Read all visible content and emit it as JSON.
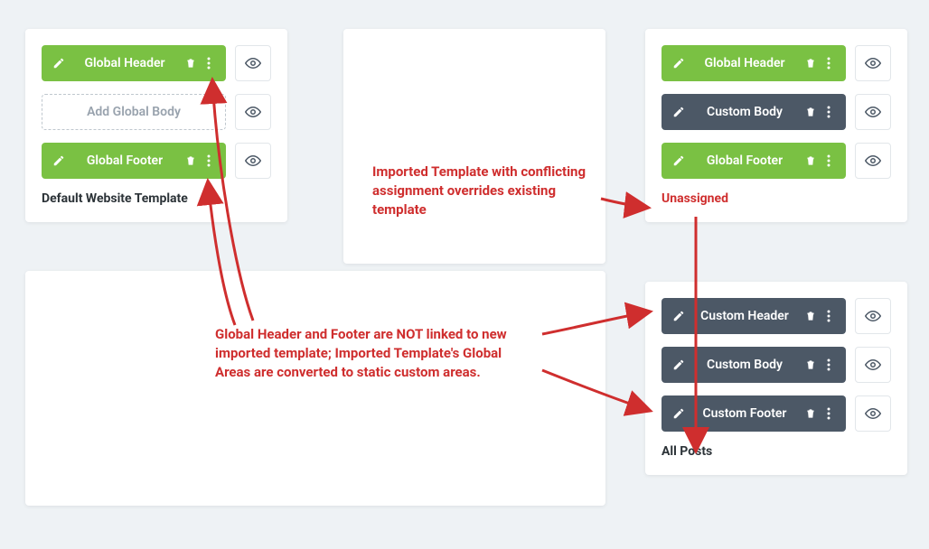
{
  "templates": {
    "default": {
      "title": "Default Website Template",
      "rows": [
        {
          "kind": "green",
          "label": "Global Header"
        },
        {
          "kind": "dashed",
          "label": "Add Global Body"
        },
        {
          "kind": "green",
          "label": "Global Footer"
        }
      ]
    },
    "unassigned": {
      "title": "Unassigned",
      "title_red": true,
      "rows": [
        {
          "kind": "green",
          "label": "Global Header"
        },
        {
          "kind": "dark",
          "label": "Custom Body"
        },
        {
          "kind": "green",
          "label": "Global Footer"
        }
      ]
    },
    "allposts": {
      "title": "All Posts",
      "rows": [
        {
          "kind": "dark",
          "label": "Custom Header"
        },
        {
          "kind": "dark",
          "label": "Custom Body"
        },
        {
          "kind": "dark",
          "label": "Custom Footer"
        }
      ]
    }
  },
  "annotations": {
    "a1": "Imported Template with conflicting assignment overrides existing template",
    "a2": "Global Header and Footer are NOT linked to new imported template; Imported Template's Global Areas are converted to static custom areas."
  }
}
